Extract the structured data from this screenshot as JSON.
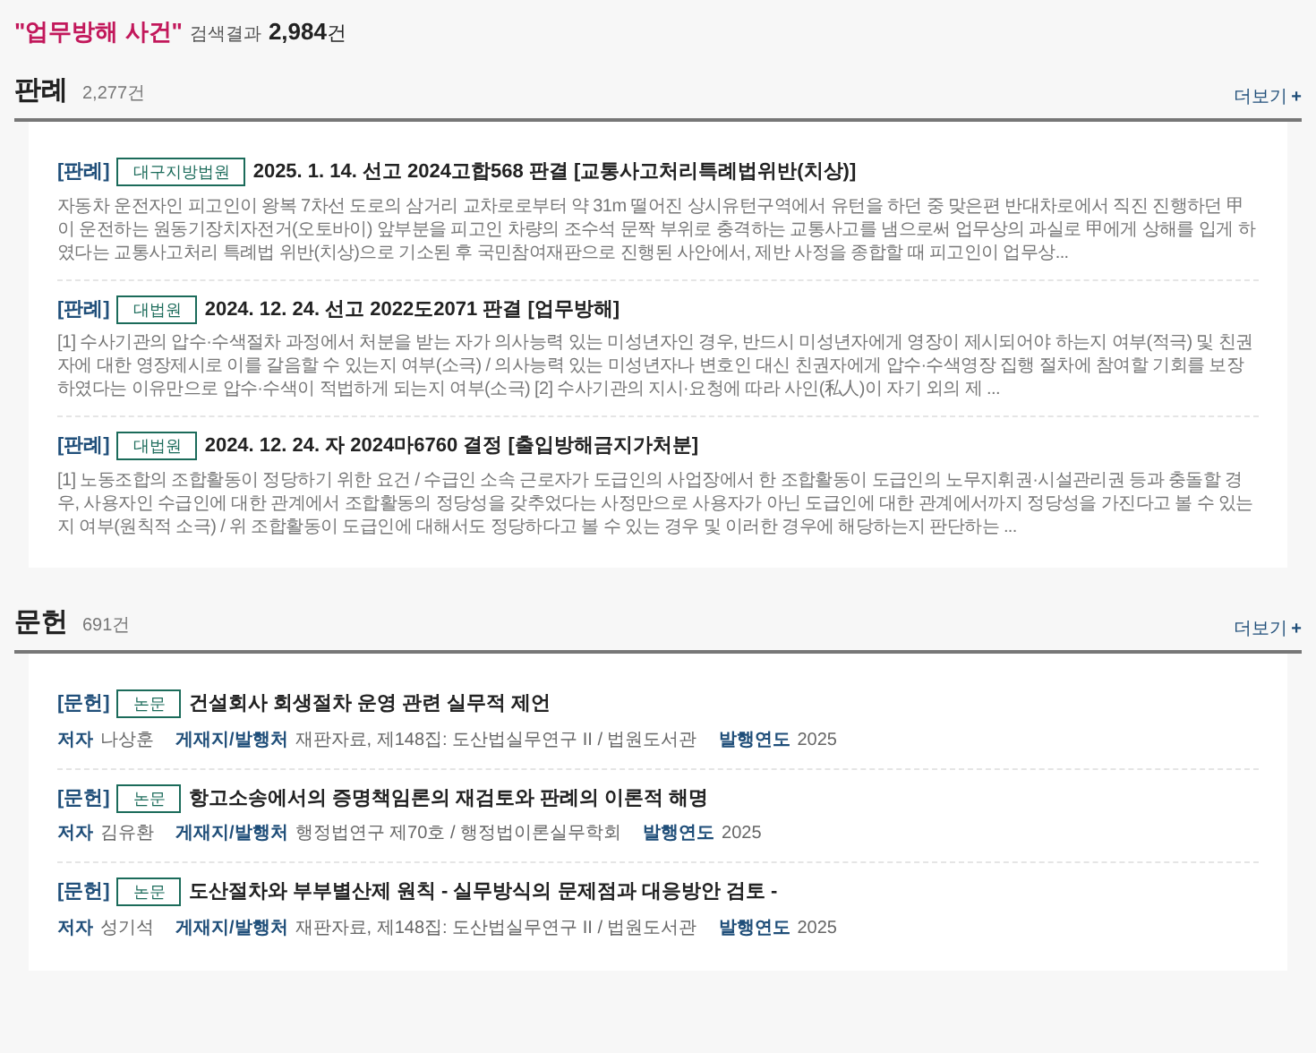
{
  "search_summary": {
    "query": "\"업무방해 사건\"",
    "label": "검색결과",
    "count": "2,984",
    "unit": "건"
  },
  "sections": [
    {
      "title": "판례",
      "count": "2,277건",
      "more": "더보기",
      "more_icon": "+",
      "kind": "case",
      "items": [
        {
          "type": "[판례]",
          "court": "대구지방법원",
          "title": "2025. 1. 14. 선고 2024고합568 판결 [교통사고처리특례법위반(치상)]",
          "summary": "자동차 운전자인 피고인이 왕복 7차선 도로의 삼거리 교차로로부터 약 31m 떨어진 상시유턴구역에서 유턴을 하던 중 맞은편 반대차로에서 직진 진행하던 甲이 운전하는 원동기장치자전거(오토바이) 앞부분을 피고인 차량의 조수석 문짝 부위로 충격하는 교통사고를 냄으로써 업무상의 과실로 甲에게 상해를 입게 하였다는 교통사고처리 특례법 위반(치상)으로 기소된 후 국민참여재판으로 진행된 사안에서, 제반 사정을 종합할 때 피고인이 업무상..."
        },
        {
          "type": "[판례]",
          "court": "대법원",
          "title": "2024. 12. 24. 선고 2022도2071 판결 [업무방해]",
          "summary": "[1] 수사기관의 압수·수색절차 과정에서 처분을 받는 자가 의사능력 있는 미성년자인 경우, 반드시 미성년자에게 영장이 제시되어야 하는지 여부(적극) 및 친권자에 대한 영장제시로 이를 갈음할 수 있는지 여부(소극) / 의사능력 있는 미성년자나 변호인 대신 친권자에게 압수·수색영장 집행 절차에 참여할 기회를 보장하였다는 이유만으로 압수·수색이 적법하게 되는지 여부(소극) [2] 수사기관의 지시·요청에 따라 사인(私人)이 자기 외의 제 ..."
        },
        {
          "type": "[판례]",
          "court": "대법원",
          "title": "2024. 12. 24. 자 2024마6760 결정 [출입방해금지가처분]",
          "summary": "[1] 노동조합의 조합활동이 정당하기 위한 요건 / 수급인 소속 근로자가 도급인의 사업장에서 한 조합활동이 도급인의 노무지휘권·시설관리권 등과 충돌할 경우, 사용자인 수급인에 대한 관계에서 조합활동의 정당성을 갖추었다는 사정만으로 사용자가 아닌 도급인에 대한 관계에서까지 정당성을 가진다고 볼 수 있는지 여부(원칙적 소극) / 위 조합활동이 도급인에 대해서도 정당하다고 볼 수 있는 경우 및 이러한 경우에 해당하는지 판단하는 ..."
        }
      ]
    },
    {
      "title": "문헌",
      "count": "691건",
      "more": "더보기",
      "more_icon": "+",
      "kind": "literature",
      "items": [
        {
          "type": "[문헌]",
          "badge": "논문",
          "title": "건설회사 회생절차 운영 관련 실무적 제언",
          "author_label": "저자",
          "author": "나상훈",
          "publisher_label": "게재지/발행처",
          "publisher": "재판자료, 제148집: 도산법실무연구 II / 법원도서관",
          "year_label": "발행연도",
          "year": "2025"
        },
        {
          "type": "[문헌]",
          "badge": "논문",
          "title": "항고소송에서의 증명책임론의 재검토와 판례의 이론적 해명",
          "author_label": "저자",
          "author": "김유환",
          "publisher_label": "게재지/발행처",
          "publisher": "행정법연구 제70호 / 행정법이론실무학회",
          "year_label": "발행연도",
          "year": "2025"
        },
        {
          "type": "[문헌]",
          "badge": "논문",
          "title": "도산절차와 부부별산제 원칙 - 실무방식의 문제점과 대응방안 검토 -",
          "author_label": "저자",
          "author": "성기석",
          "publisher_label": "게재지/발행처",
          "publisher": "재판자료, 제148집: 도산법실무연구 II / 법원도서관",
          "year_label": "발행연도",
          "year": "2025"
        }
      ]
    }
  ]
}
